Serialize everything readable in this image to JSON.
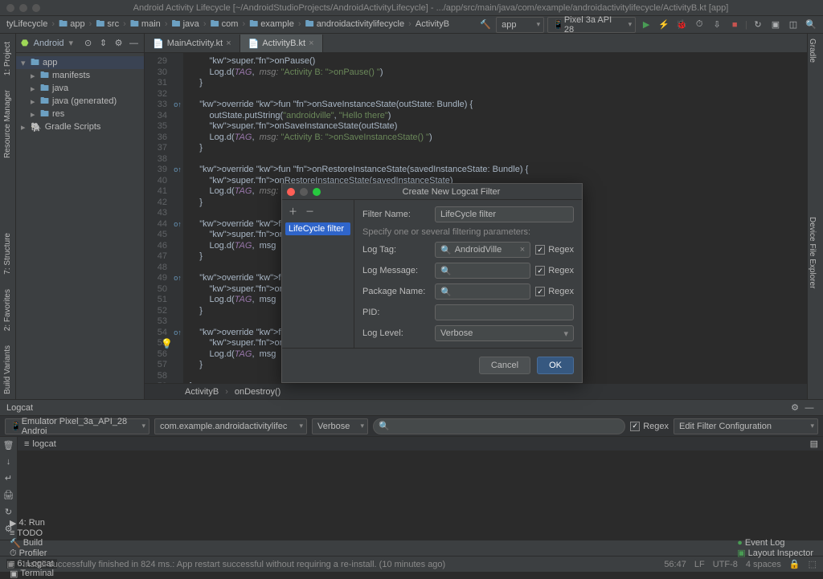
{
  "window_title": "Android Activity Lifecycle [~/AndroidStudioProjects/AndroidActivityLifecycle] - .../app/src/main/java/com/example/androidactivitylifecycle/ActivityB.kt [app]",
  "breadcrumbs": [
    "tyLifecycle",
    "app",
    "src",
    "main",
    "java",
    "com",
    "example",
    "androidactivitylifecycle",
    "ActivityB"
  ],
  "run_config": "app",
  "device_label": "Pixel 3a API 28",
  "left_rail_tabs": [
    "1: Project",
    "Resource Manager"
  ],
  "project_dropdown": "Android",
  "project_tree": [
    {
      "label": "app",
      "icon": "module",
      "expanded": true,
      "sel": true
    },
    {
      "label": "manifests",
      "indent": 1,
      "arrow": "▸"
    },
    {
      "label": "java",
      "indent": 1,
      "arrow": "▸"
    },
    {
      "label": "java (generated)",
      "indent": 1,
      "arrow": "▸"
    },
    {
      "label": "res",
      "indent": 1,
      "arrow": "▸"
    },
    {
      "label": "Gradle Scripts",
      "indent": 0,
      "arrow": "▸",
      "icon": "gradle"
    }
  ],
  "editor_tabs": [
    {
      "label": "MainActivity.kt",
      "active": false
    },
    {
      "label": "ActivityB.kt",
      "active": true
    }
  ],
  "line_start": 29,
  "line_end": 59,
  "gutter_markers": {
    "33": "o↑",
    "39": "o↑",
    "44": "o↑",
    "49": "o↑",
    "54": "o↑"
  },
  "code_lines": [
    "        super.onPause()",
    "        Log.d(TAG,  msg: \"Activity B: onPause() \")",
    "    }",
    "",
    "    override fun onSaveInstanceState(outState: Bundle) {",
    "        outState.putString(\"androidville\", \"Hello there\")",
    "        super.onSaveInstanceState(outState)",
    "        Log.d(TAG,  msg: \"Activity B: onSaveInstanceState() \")",
    "    }",
    "",
    "    override fun onRestoreInstanceState(savedInstanceState: Bundle) {",
    "        super.onRestoreInstanceState(savedInstanceState)",
    "        Log.d(TAG,  msg: \"Activity B: onRestoreInstanceState() \")",
    "    }",
    "",
    "    override fun onResta",
    "        super.onRestart(",
    "        Log.d(TAG,  msg",
    "    }",
    "",
    "    override fun onStop(",
    "        super.onStop()",
    "        Log.d(TAG,  msg",
    "    }",
    "",
    "    override fun onDestr",
    "        super.onDestroy(",
    "        Log.d(TAG,  msg",
    "    }",
    "",
    "}"
  ],
  "editor_breadcrumb": [
    "ActivityB",
    "onDestroy()"
  ],
  "right_rail_tabs": [
    "Gradle",
    "Device File Explorer"
  ],
  "left_rail_bottom": [
    "2: Favorites",
    "Build Variants",
    "7: Structure"
  ],
  "logcat": {
    "header": "Logcat",
    "device": "Emulator Pixel_3a_API_28 Androi",
    "package": "com.example.androidactivitylifec",
    "level": "Verbose",
    "regex_label": "Regex",
    "regex_checked": true,
    "filter_config": "Edit Filter Configuration",
    "tab_label": "logcat"
  },
  "tool_windows": [
    {
      "icon": "▶",
      "label": "4: Run"
    },
    {
      "icon": "≡",
      "label": "TODO"
    },
    {
      "icon": "🔨",
      "label": "Build"
    },
    {
      "icon": "⏱",
      "label": "Profiler"
    },
    {
      "icon": "≡",
      "label": "6: Logcat",
      "active": true
    },
    {
      "icon": "▣",
      "label": "Terminal"
    }
  ],
  "tool_right": [
    {
      "icon": "●",
      "label": "Event Log"
    },
    {
      "icon": "▣",
      "label": "Layout Inspector"
    }
  ],
  "status_message": "Install successfully finished in 824 ms.: App restart successful without requiring a re-install. (10 minutes ago)",
  "status_right": [
    "56:47",
    "LF",
    "UTF-8",
    "4 spaces",
    "🔒",
    "⬚"
  ],
  "dialog": {
    "title": "Create New Logcat Filter",
    "list_item": "LifeCycle filter",
    "filter_name_label": "Filter Name:",
    "filter_name_value": "LifeCycle filter",
    "help": "Specify one or several filtering parameters:",
    "log_tag_label": "Log Tag:",
    "log_tag_value": "AndroidVille",
    "log_message_label": "Log Message:",
    "package_name_label": "Package Name:",
    "pid_label": "PID:",
    "log_level_label": "Log Level:",
    "log_level_value": "Verbose",
    "regex_label": "Regex",
    "cancel": "Cancel",
    "ok": "OK"
  }
}
